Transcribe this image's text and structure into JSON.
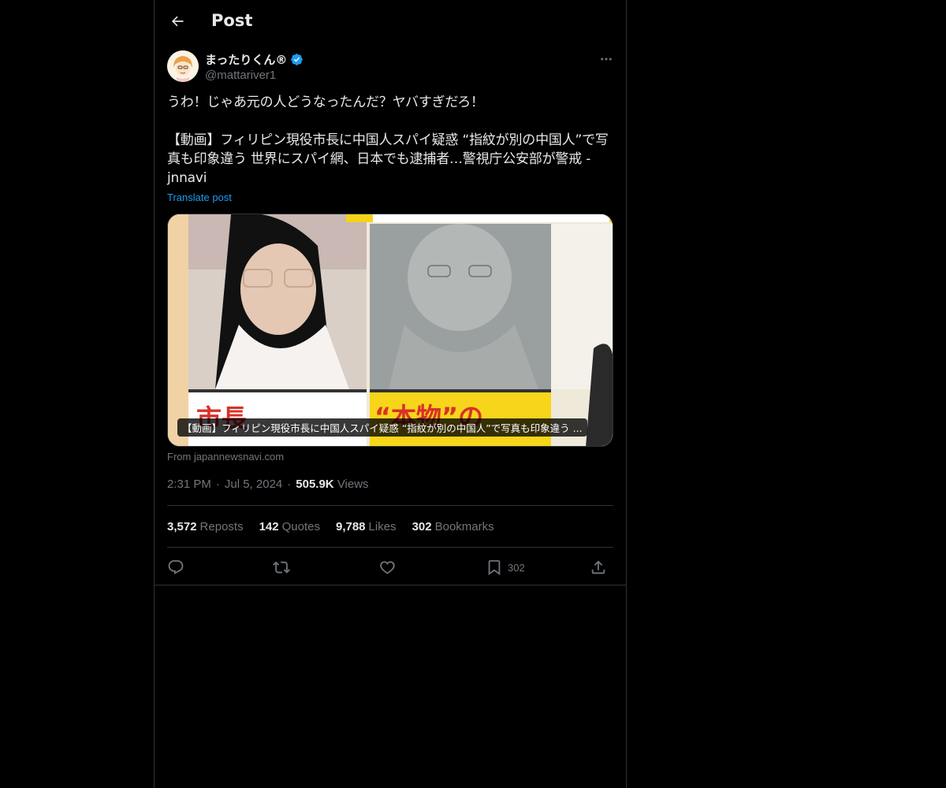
{
  "header": {
    "title": "Post"
  },
  "author": {
    "name": "まったりくん®",
    "handle": "@mattariver1",
    "verified": true
  },
  "post": {
    "line1": "うわ！じゃあ元の人どうなったんだ？ヤバすぎだろ！",
    "line2": "【動画】フィリピン現役市長に中国人スパイ疑惑 “指紋が別の中国人”で写真も印象違う 世界にスパイ網、日本でも逮捕者…警視庁公安部が警戒 - jnnavi",
    "translate_label": "Translate post"
  },
  "card": {
    "caption": "【動画】フィリピン現役市長に中国人スパイ疑惑 “指紋が別の中国人”で写真も印象違う ...",
    "image_left_label": "市長",
    "image_right_label": "“本物”の",
    "source": "From japannewsnavi.com"
  },
  "meta": {
    "time": "2:31 PM",
    "date": "Jul 5, 2024",
    "views_count": "505.9K",
    "views_label": "Views"
  },
  "stats": {
    "reposts_count": "3,572",
    "reposts_label": "Reposts",
    "quotes_count": "142",
    "quotes_label": "Quotes",
    "likes_count": "9,788",
    "likes_label": "Likes",
    "bookmarks_count": "302",
    "bookmarks_label": "Bookmarks"
  },
  "actions": {
    "bookmark_count": "302"
  },
  "colors": {
    "background": "#000000",
    "text": "#e7e9ea",
    "muted": "#71767b",
    "accent": "#1d9bf0",
    "border": "#2f3336"
  },
  "icons": {
    "back": "arrow-left-icon",
    "more": "more-horizontal-icon",
    "verified": "verified-badge-icon",
    "reply": "reply-icon",
    "repost": "repost-icon",
    "like": "heart-icon",
    "bookmark": "bookmark-icon",
    "share": "share-icon"
  }
}
